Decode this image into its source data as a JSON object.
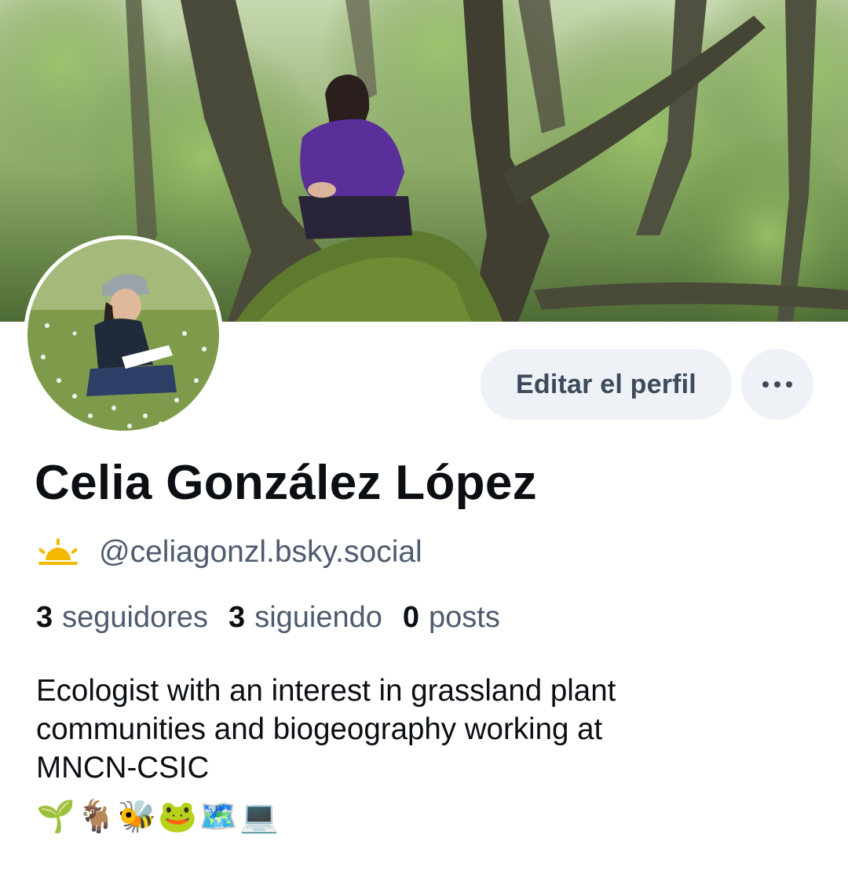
{
  "profile": {
    "display_name": "Celia González López",
    "handle": "@celiagonzl.bsky.social",
    "handle_icon": "sunrise-icon",
    "edit_button_label": "Editar el perfil",
    "more_button_icon": "ellipsis-icon"
  },
  "stats": {
    "followers": {
      "count": "3",
      "label": "seguidores"
    },
    "following": {
      "count": "3",
      "label": "siguiendo"
    },
    "posts": {
      "count": "0",
      "label": "posts"
    }
  },
  "bio": {
    "lines": [
      "Ecologist with an interest in grassland plant",
      "communities and biogeography working at",
      "MNCN-CSIC"
    ],
    "emojis": "🌱🐐🐝🐸🗺️💻"
  },
  "colors": {
    "text_primary": "#0b0f14",
    "text_secondary": "#4d5b6e",
    "button_bg": "#eef1f5",
    "sun_accent": "#f5b800"
  }
}
